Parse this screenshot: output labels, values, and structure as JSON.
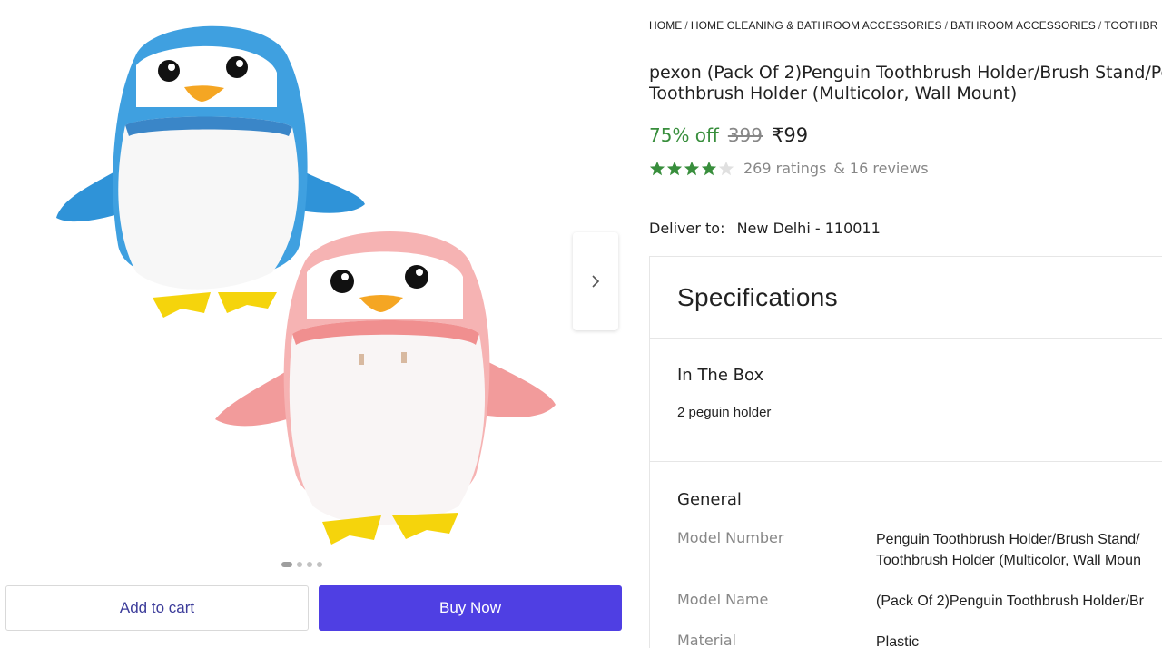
{
  "breadcrumb": [
    "HOME",
    "HOME CLEANING & BATHROOM ACCESSORIES",
    "BATHROOM ACCESSORIES",
    "TOOTHBR"
  ],
  "product": {
    "title_line1": "pexon (Pack Of 2)Penguin Toothbrush Holder/Brush Stand/Pe",
    "title_line2": "Toothbrush Holder (Multicolor, Wall Mount)",
    "discount": "75% off",
    "mrp": "399",
    "price": "₹99",
    "rating_value": 4,
    "rating_max": 5,
    "ratings_count": "269 ratings",
    "reviews_count": "& 16 reviews",
    "image_name": "penguin-toothbrush-holders-image"
  },
  "gallery": {
    "image_count": 4,
    "active_index": 0
  },
  "actions": {
    "add_to_cart": "Add to cart",
    "buy_now": "Buy Now"
  },
  "delivery": {
    "label": "Deliver to:",
    "location": "New Delhi - 110011"
  },
  "specifications": {
    "heading": "Specifications",
    "in_the_box": {
      "title": "In The Box",
      "item": "2 peguin holder"
    },
    "general": {
      "title": "General",
      "rows": [
        {
          "key": "Model Number",
          "value_line1": "Penguin Toothbrush Holder/Brush Stand/",
          "value_line2": "Toothbrush Holder (Multicolor, Wall Moun"
        },
        {
          "key": "Model Name",
          "value_line1": "(Pack Of 2)Penguin Toothbrush Holder/Br",
          "value_line2": ""
        },
        {
          "key": "Material",
          "value_line1": "Plastic",
          "value_line2": ""
        }
      ]
    }
  },
  "colors": {
    "discount_green": "#388e3c",
    "star_green": "#388e3c",
    "buy_now_bg": "#4f3fe3",
    "cart_text": "#3c3c9a",
    "penguin_blue": "#3fa0e0",
    "penguin_pink": "#f4a6a6"
  }
}
